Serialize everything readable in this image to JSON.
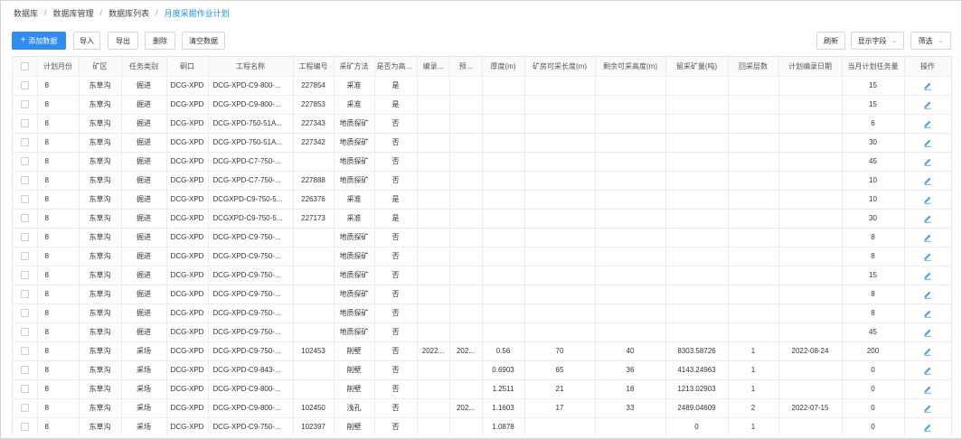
{
  "breadcrumb": [
    "数据库",
    "数据库管理",
    "数据库列表",
    "月度采掘作业计划"
  ],
  "toolbar": {
    "add": "添加数据",
    "import": "导入",
    "export": "导出",
    "delete": "删除",
    "clear": "清空数据",
    "refresh": "刷新",
    "show_fields": "显示字段",
    "filter": "筛选"
  },
  "table": {
    "columns": [
      "计划月份",
      "矿区",
      "任务类别",
      "硐口",
      "工程名称",
      "工程编号",
      "采矿方法",
      "是否为高危...",
      "编录...",
      "预...",
      "厚度(m)",
      "矿房可采长度(m)",
      "剩余可采高度(m)",
      "留采矿量(吨)",
      "回采层数",
      "计划编录日期",
      "当月计划任务量",
      "操作"
    ],
    "rows": [
      [
        "8",
        "东草沟",
        "掘进",
        "DCG-XPD",
        "DCG-XPD-C9-800-...",
        "227854",
        "采准",
        "是",
        "",
        "",
        "",
        "",
        "",
        "",
        "",
        "",
        "15"
      ],
      [
        "8",
        "东草沟",
        "掘进",
        "DCG-XPD",
        "DCG-XPD-C9-800-...",
        "227853",
        "采准",
        "是",
        "",
        "",
        "",
        "",
        "",
        "",
        "",
        "",
        "15"
      ],
      [
        "8",
        "东草沟",
        "掘进",
        "DCG-XPD",
        "DCG-XPD-750-51A...",
        "227343",
        "地质探矿",
        "否",
        "",
        "",
        "",
        "",
        "",
        "",
        "",
        "",
        "6"
      ],
      [
        "8",
        "东草沟",
        "掘进",
        "DCG-XPD",
        "DCG-XPD-750-51A...",
        "227342",
        "地质探矿",
        "否",
        "",
        "",
        "",
        "",
        "",
        "",
        "",
        "",
        "30"
      ],
      [
        "8",
        "东草沟",
        "掘进",
        "DCG-XPD",
        "DCG-XPD-C7-750-...",
        "",
        "地质探矿",
        "否",
        "",
        "",
        "",
        "",
        "",
        "",
        "",
        "",
        "45"
      ],
      [
        "8",
        "东草沟",
        "掘进",
        "DCG-XPD",
        "DCG-XPD-C7-750-...",
        "227888",
        "地质探矿",
        "否",
        "",
        "",
        "",
        "",
        "",
        "",
        "",
        "",
        "10"
      ],
      [
        "8",
        "东草沟",
        "掘进",
        "DCG-XPD",
        "DCGXPD-C9-750-5...",
        "226376",
        "采准",
        "是",
        "",
        "",
        "",
        "",
        "",
        "",
        "",
        "",
        "10"
      ],
      [
        "8",
        "东草沟",
        "掘进",
        "DCG-XPD",
        "DCGXPD-C9-750-5...",
        "227173",
        "采准",
        "是",
        "",
        "",
        "",
        "",
        "",
        "",
        "",
        "",
        "30"
      ],
      [
        "8",
        "东草沟",
        "掘进",
        "DCG-XPD",
        "DCG-XPD-C9-750-...",
        "",
        "地质探矿",
        "否",
        "",
        "",
        "",
        "",
        "",
        "",
        "",
        "",
        "8"
      ],
      [
        "8",
        "东草沟",
        "掘进",
        "DCG-XPD",
        "DCG-XPD-C9-750-...",
        "",
        "地质探矿",
        "否",
        "",
        "",
        "",
        "",
        "",
        "",
        "",
        "",
        "8"
      ],
      [
        "8",
        "东草沟",
        "掘进",
        "DCG-XPD",
        "DCG-XPD-C9-750-...",
        "",
        "地质探矿",
        "否",
        "",
        "",
        "",
        "",
        "",
        "",
        "",
        "",
        "15"
      ],
      [
        "8",
        "东草沟",
        "掘进",
        "DCG-XPD",
        "DCG-XPD-C9-750-...",
        "",
        "地质探矿",
        "否",
        "",
        "",
        "",
        "",
        "",
        "",
        "",
        "",
        "8"
      ],
      [
        "8",
        "东草沟",
        "掘进",
        "DCG-XPD",
        "DCG-XPD-C9-750-...",
        "",
        "地质探矿",
        "否",
        "",
        "",
        "",
        "",
        "",
        "",
        "",
        "",
        "8"
      ],
      [
        "8",
        "东草沟",
        "掘进",
        "DCG-XPD",
        "DCG-XPD-C9-750-...",
        "",
        "地质探矿",
        "否",
        "",
        "",
        "",
        "",
        "",
        "",
        "",
        "",
        "45"
      ],
      [
        "8",
        "东草沟",
        "采场",
        "DCG-XPD",
        "DCG-XPD-C9-750-...",
        "102453",
        "削壁",
        "否",
        "2022...",
        "202...",
        "0.56",
        "70",
        "40",
        "8303.58726",
        "1",
        "2022-08-24",
        "200"
      ],
      [
        "8",
        "东草沟",
        "采场",
        "DCG-XPD",
        "DCG-XPD-C9-843-...",
        "",
        "削壁",
        "否",
        "",
        "",
        "0.6903",
        "65",
        "36",
        "4143.24963",
        "1",
        "",
        "0"
      ],
      [
        "8",
        "东草沟",
        "采场",
        "DCG-XPD",
        "DCG-XPD-C9-800-...",
        "",
        "削壁",
        "否",
        "",
        "",
        "1.2511",
        "21",
        "18",
        "1213.02903",
        "1",
        "",
        "0"
      ],
      [
        "8",
        "东草沟",
        "采场",
        "DCG-XPD",
        "DCG-XPD-C9-800-...",
        "102450",
        "浅孔",
        "否",
        "",
        "202...",
        "1.1603",
        "17",
        "33",
        "2489.04609",
        "2",
        "2022-07-15",
        "0"
      ],
      [
        "8",
        "东草沟",
        "采场",
        "DCG-XPD",
        "DCG-XPD-C9-750-...",
        "102397",
        "削壁",
        "否",
        "",
        "",
        "1.0878",
        "",
        "",
        "0",
        "1",
        "",
        "0"
      ]
    ]
  },
  "colors": {
    "accent": "#2f8cf0",
    "breadcrumb_current": "#1a8fff"
  },
  "icons": {
    "row_action": "edit-icon"
  }
}
